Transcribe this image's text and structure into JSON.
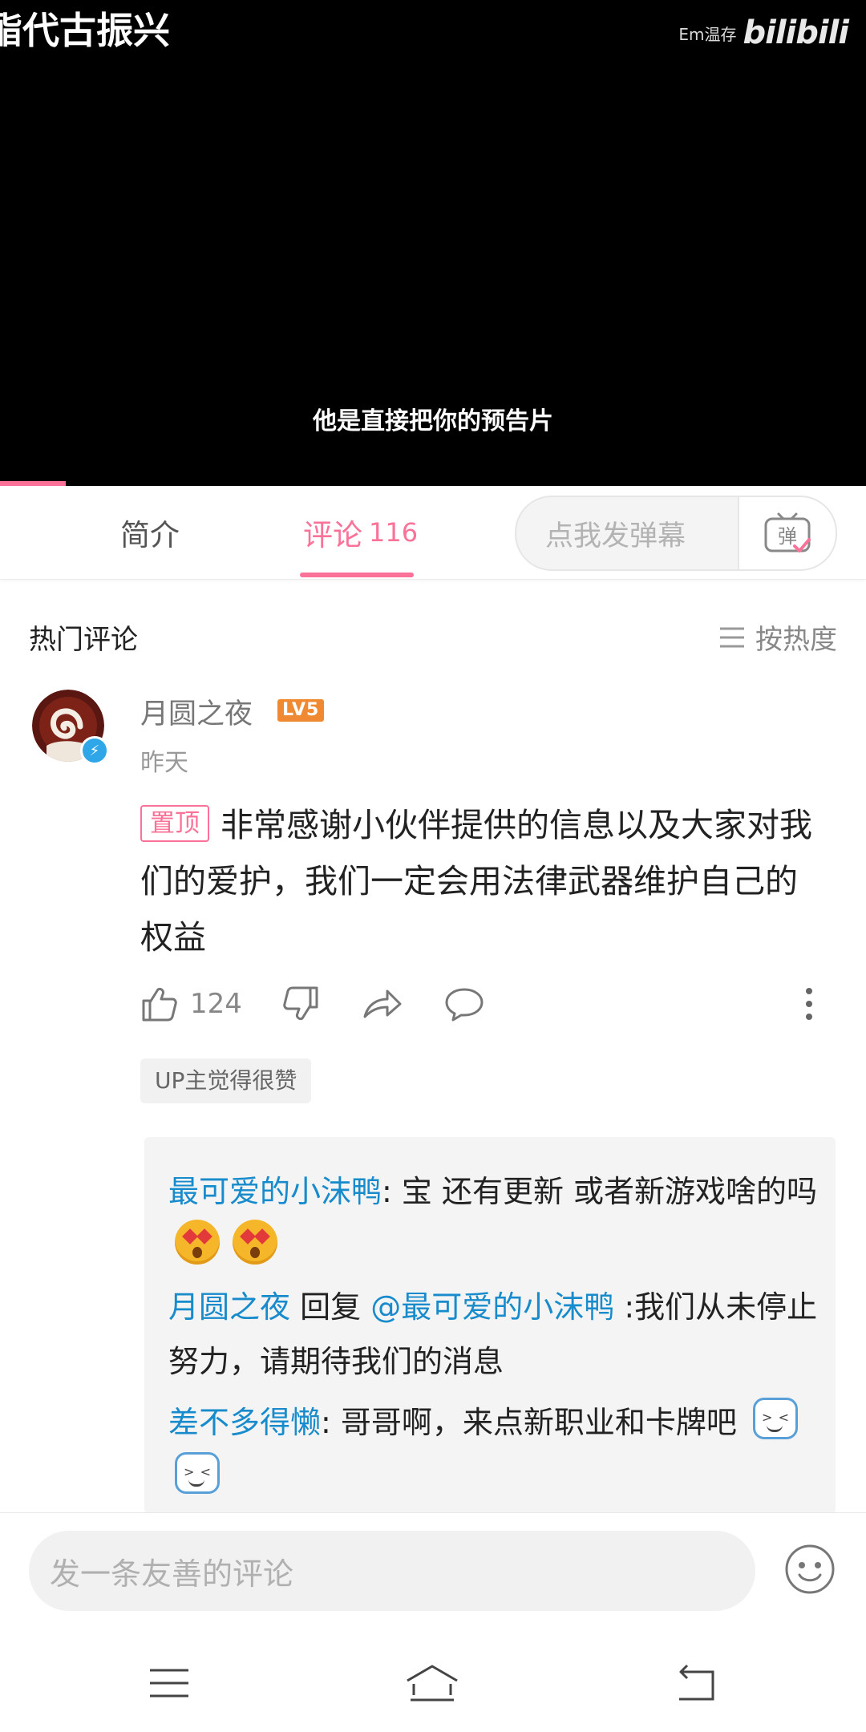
{
  "video": {
    "title": "酯代古振兴",
    "watermark_user": "Em温存",
    "watermark_logo": "bilibili",
    "subtitle": "他是直接把你的预告片",
    "progress_fraction": 0.076
  },
  "tabs": {
    "intro": "简介",
    "comments": "评论",
    "comments_count": "116"
  },
  "danmaku": {
    "placeholder": "点我发弹幕",
    "button_label": "弹"
  },
  "section": {
    "title": "热门评论",
    "sort_label": "按热度"
  },
  "comment": {
    "username": "月圆之夜",
    "level": "LV5",
    "time": "昨天",
    "pin_label": "置顶",
    "text": "非常感谢小伙伴提供的信息以及大家对我们的爱护，我们一定会用法律武器维护自己的权益",
    "like_count": "124",
    "up_badge": "UP主觉得很赞"
  },
  "replies": [
    {
      "nick": "最可爱的小沫鸭",
      "text": ": 宝 还有更新 或者新游戏啥的吗"
    },
    {
      "nick": "月圆之夜",
      "reply_word": "回复",
      "mention": "@最可爱的小沫鸭",
      "text": ":我们从未停止努力，请期待我们的消息"
    },
    {
      "nick": "差不多得懒",
      "text": ": 哥哥啊，来点新职业和卡牌吧"
    }
  ],
  "input": {
    "placeholder": "发一条友善的评论"
  },
  "colors": {
    "accent": "#fb7299",
    "link": "#178bcb",
    "level": "#f08a32"
  },
  "icons": [
    "like-icon",
    "dislike-icon",
    "share-icon",
    "reply-icon",
    "more-icon",
    "emoji-icon",
    "menu-icon",
    "home-icon",
    "back-icon"
  ]
}
